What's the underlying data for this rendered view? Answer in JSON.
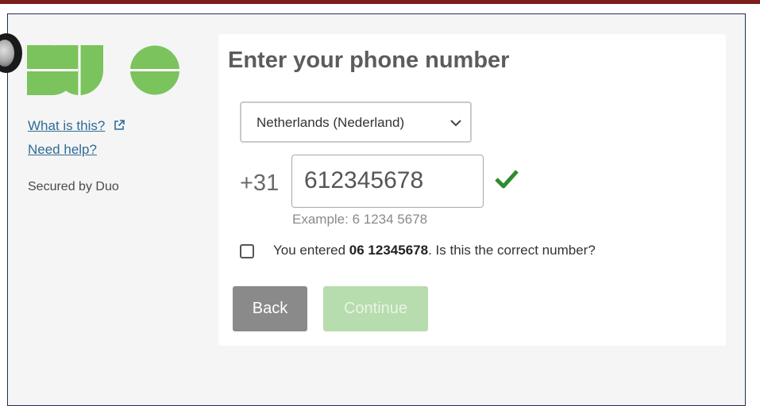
{
  "colors": {
    "top_bar": "#7a1e1e",
    "duo_green": "#7bc35c",
    "link_blue": "#2f6b96",
    "back_button": "#8a8a8a",
    "continue_button_disabled": "#b7dcae",
    "check_green": "#2e8b2e"
  },
  "sidebar": {
    "what_is_this": "What is this?",
    "need_help": "Need help?",
    "secured_by": "Secured by Duo"
  },
  "main": {
    "title": "Enter your phone number",
    "country_select": {
      "value": "Netherlands (Nederland)"
    },
    "phone": {
      "prefix": "+31",
      "value": "612345678",
      "example": "Example: 6 1234 5678",
      "valid_icon": "checkmark-icon"
    },
    "confirm": {
      "checked": false,
      "prefix": "You entered ",
      "number": "06 12345678",
      "suffix": ". Is this the correct number?"
    },
    "buttons": {
      "back": "Back",
      "continue": "Continue"
    }
  }
}
